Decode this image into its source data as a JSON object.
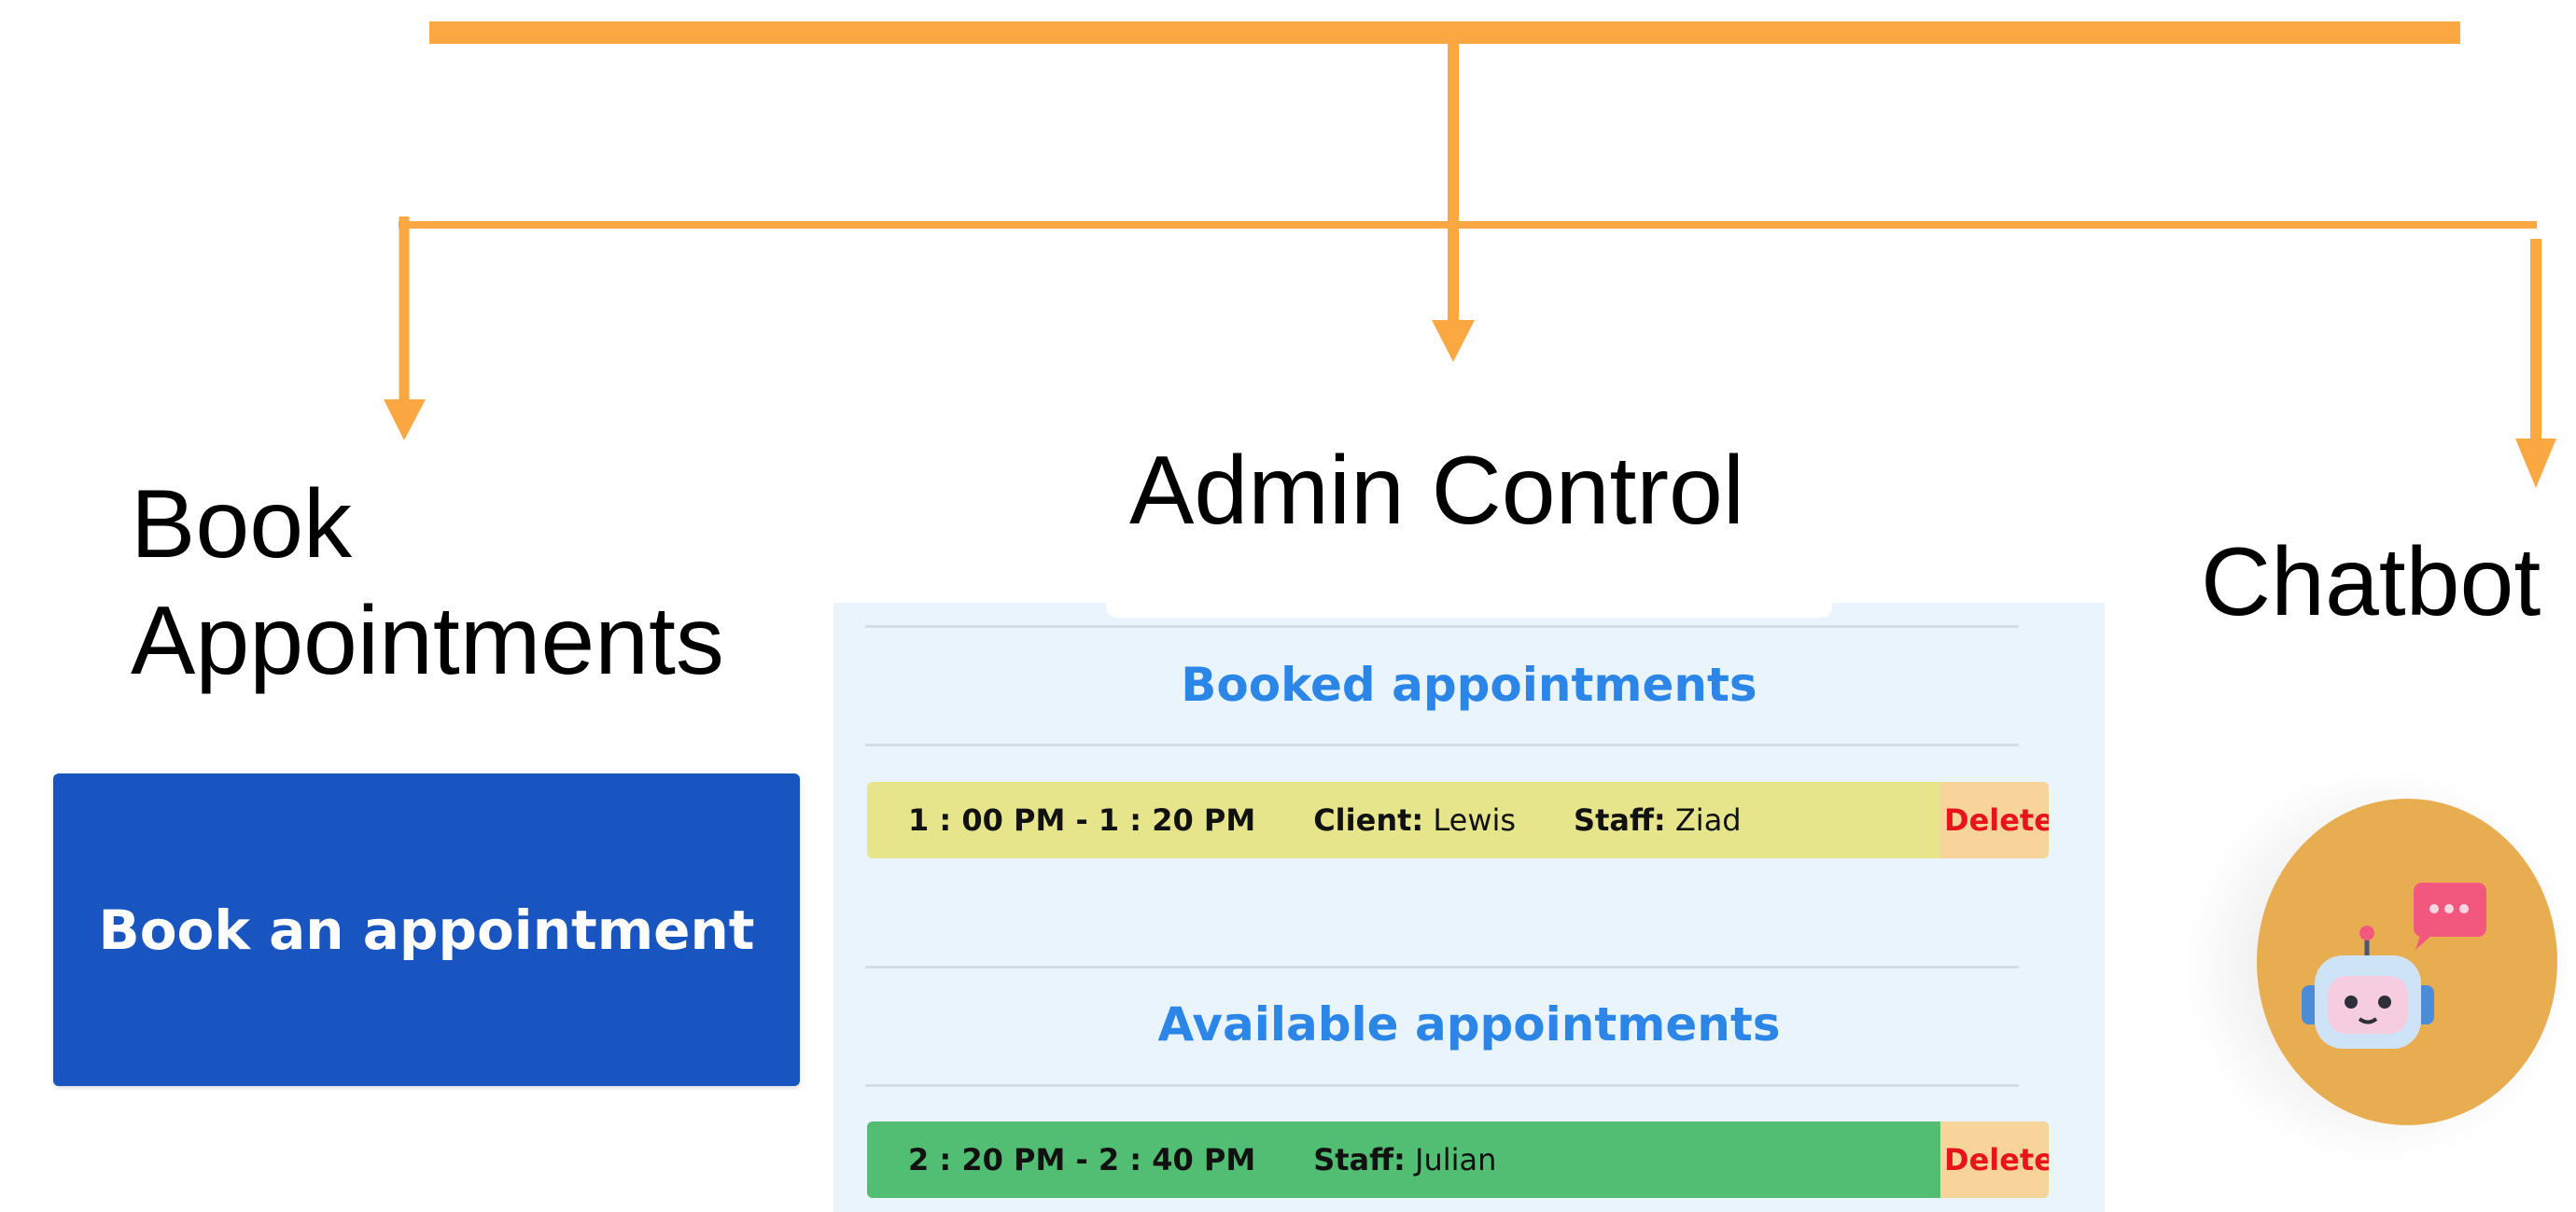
{
  "headings": {
    "book": [
      "Book",
      "Appointments"
    ],
    "admin": "Admin Control",
    "chatbot": "Chatbot"
  },
  "book_button": {
    "label": "Book an appointment"
  },
  "admin_panel": {
    "booked": {
      "title": "Booked appointments",
      "rows": [
        {
          "time": "1 : 00 PM - 1 : 20 PM",
          "client_label": "Client:",
          "client": "Lewis",
          "staff_label": "Staff:",
          "staff": "Ziad",
          "delete_label": "Delete"
        }
      ]
    },
    "available": {
      "title": "Available appointments",
      "rows": [
        {
          "time": "2 : 20 PM - 2 : 40 PM",
          "staff_label": "Staff:",
          "staff": "Julian",
          "delete_label": "Delete"
        }
      ]
    }
  },
  "chatbot": {
    "icon": "robot-chat-icon"
  },
  "colors": {
    "connector": "#fba843",
    "book_button_bg": "#1955c0",
    "section_title": "#2b86e8",
    "booked_row": "#e6e58b",
    "available_row": "#52be73",
    "delete_text": "#e8141b",
    "delete_bg": "#f7d59a",
    "chatbot_bg": "#e8ad50"
  }
}
